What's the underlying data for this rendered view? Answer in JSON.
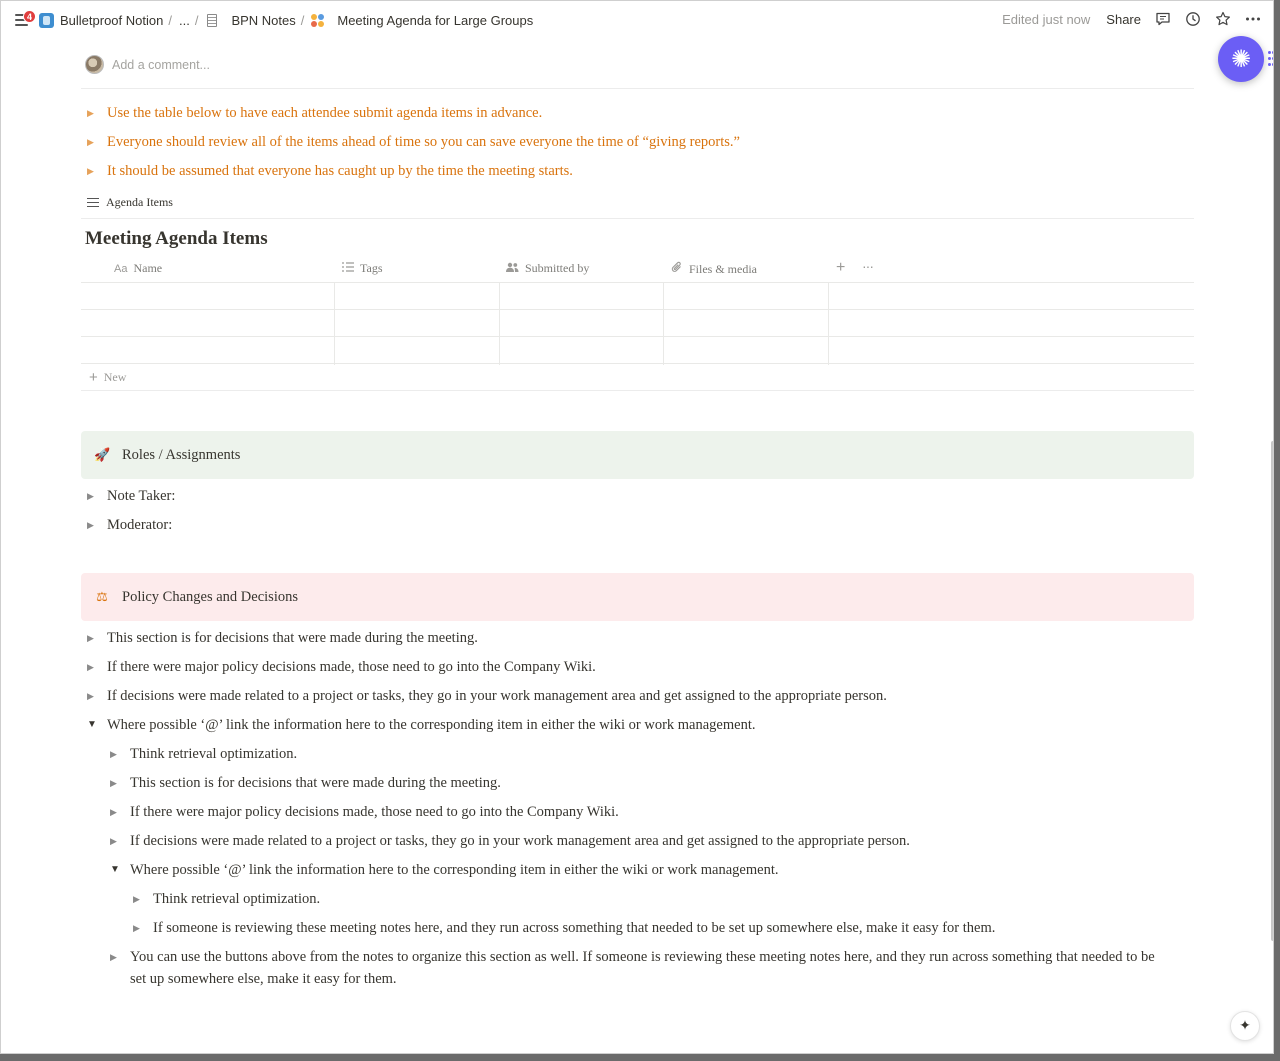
{
  "topbar": {
    "notification_count": "4",
    "breadcrumbs": [
      {
        "label": "Bulletproof Notion"
      },
      {
        "label": "..."
      },
      {
        "label": "BPN Notes"
      },
      {
        "label": "Meeting Agenda for Large Groups"
      }
    ],
    "edited": "Edited just now",
    "share": "Share"
  },
  "comment": {
    "placeholder": "Add a comment..."
  },
  "intro_toggles": [
    "Use the table below to have each attendee submit agenda items in advance.",
    "Everyone should review all of the items ahead of time so you can save everyone the time of “giving reports.”",
    "It should be assumed that everyone has caught up by the time the meeting starts."
  ],
  "database": {
    "view_label": "Agenda Items",
    "title": "Meeting Agenda Items",
    "columns": [
      {
        "label": "Name",
        "icon": "Aa"
      },
      {
        "label": "Tags"
      },
      {
        "label": "Submitted by"
      },
      {
        "label": "Files & media"
      }
    ],
    "new_label": "New"
  },
  "roles": {
    "heading": "Roles / Assignments",
    "emoji": "🚀",
    "items": [
      "Note Taker:",
      "Moderator:"
    ]
  },
  "policy": {
    "heading": "Policy Changes and Decisions",
    "emoji": "⚖",
    "items": [
      "This section is for decisions that were made during the meeting.",
      "If there were major policy decisions made, those need to go into the Company Wiki.",
      "If decisions were made related to a project or tasks, they go in your work management area and get assigned to the appropriate person.",
      "Where possible ‘@’ link the information here to the corresponding item in either the wiki or work management."
    ],
    "nested": [
      "Think retrieval optimization.",
      "This section is for decisions that were made during the meeting.",
      "If there were major policy decisions made, those need to go into the Company Wiki.",
      "If decisions were made related to a project or tasks, they go in your work management area and get assigned to the appropriate person.",
      "Where possible ‘@’ link the information here to the corresponding item in either the wiki or work management."
    ],
    "nested2": [
      "Think retrieval optimization.",
      "If someone is reviewing these meeting notes here, and they run across something that needed to be set up somewhere else, make it easy for them."
    ],
    "last_line1": "You can use the buttons above from the notes to organize this section as well. If someone is reviewing these meeting notes here, and they run across something that needed to be",
    "last_line2": "set up somewhere else, make it easy for them."
  },
  "colors": {
    "accent": "#6b5ef5",
    "orange_text": "#d9730d",
    "green_callout": "#edf3ec",
    "red_callout": "#fdebec"
  }
}
